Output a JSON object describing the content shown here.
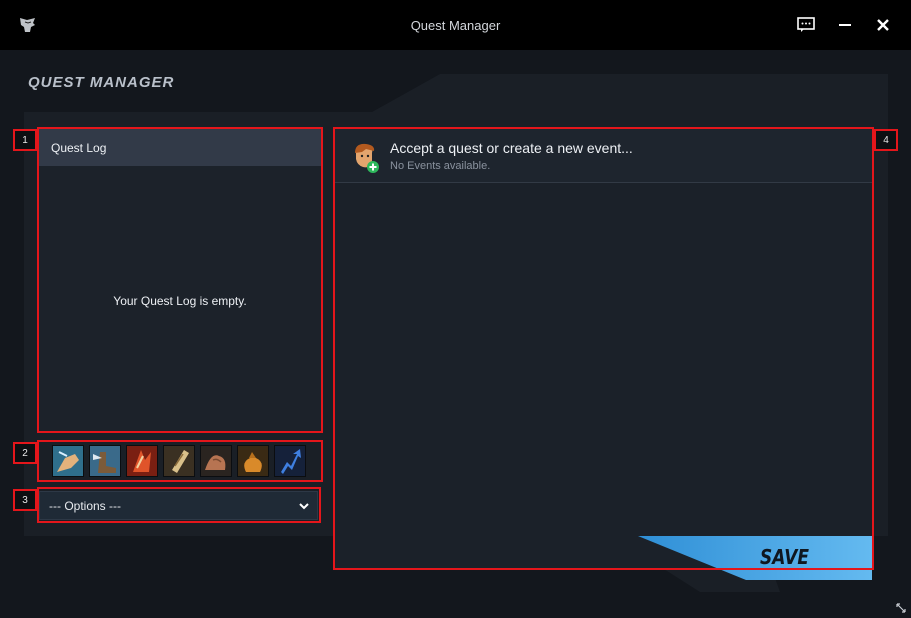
{
  "window": {
    "title": "Quest Manager",
    "icons": {
      "logo": "wolf-logo-icon",
      "chat": "chat-icon",
      "minimize": "minimize-icon",
      "close": "close-icon"
    }
  },
  "header": {
    "title": "QUEST MANAGER"
  },
  "quest_log": {
    "title": "Quest Log",
    "empty_text": "Your Quest Log is empty."
  },
  "skill_icons": [
    {
      "name": "fist-punch-icon"
    },
    {
      "name": "winged-boot-icon"
    },
    {
      "name": "fire-claw-icon"
    },
    {
      "name": "scroll-icon"
    },
    {
      "name": "flex-arm-icon"
    },
    {
      "name": "gold-sack-icon"
    },
    {
      "name": "blue-arrow-up-icon"
    }
  ],
  "options": {
    "selected": "--- Options ---"
  },
  "events": {
    "title": "Accept a quest or create a new event...",
    "subtitle": "No Events available."
  },
  "save": {
    "label": "SAVE"
  },
  "annotations": {
    "n1": "1",
    "n2": "2",
    "n3": "3",
    "n4": "4"
  },
  "colors": {
    "accent_blue": "#4aa8e6",
    "annotation_red": "#e4161b",
    "panel": "#1a1f26"
  }
}
